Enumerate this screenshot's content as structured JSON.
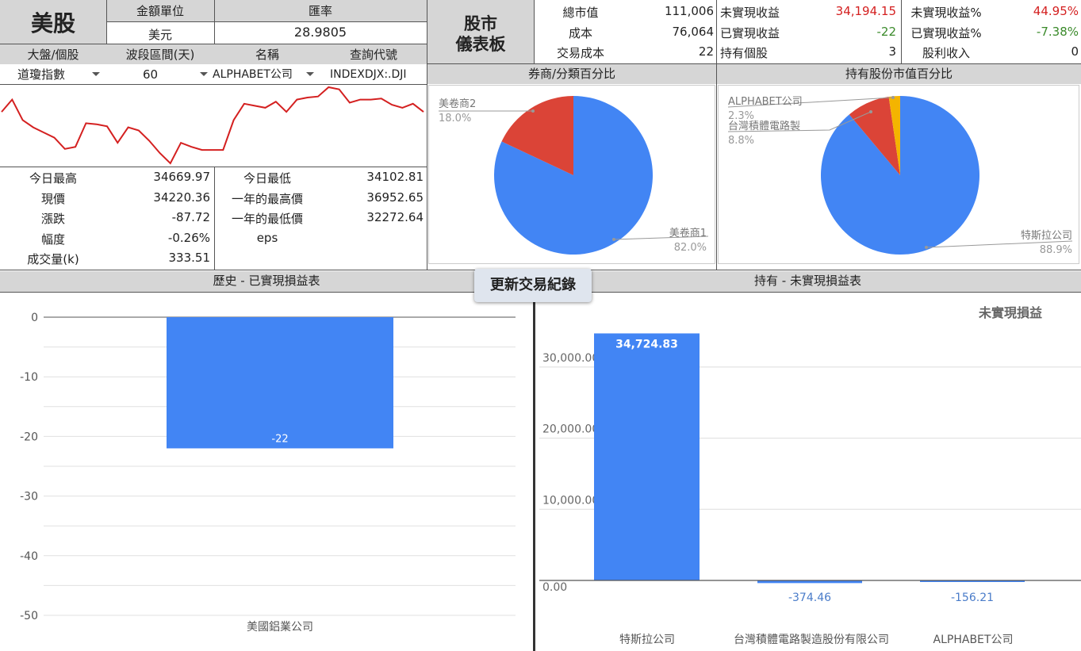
{
  "market": {
    "title": "美股",
    "amount_unit_label": "金額單位",
    "amount_unit_value": "美元",
    "exchange_rate_label": "匯率",
    "exchange_rate_value": "28.9805",
    "col_headers": [
      "大盤/個股",
      "波段區間(天)",
      "名稱",
      "查詢代號"
    ],
    "select_index": "道瓊指數",
    "select_days": "60",
    "select_name": "ALPHABET公司",
    "query_code": "INDEXDJX:.DJI",
    "sparkline": [
      34380,
      34500,
      34300,
      34230,
      34180,
      34130,
      34020,
      34040,
      34270,
      34260,
      34240,
      34080,
      34230,
      34200,
      34100,
      33980,
      33880,
      34080,
      34040,
      34010,
      34010,
      34010,
      34300,
      34460,
      34440,
      34420,
      34480,
      34380,
      34500,
      34520,
      34530,
      34620,
      34600,
      34470,
      34500,
      34500,
      34510,
      34450,
      34420,
      34460,
      34380
    ]
  },
  "stats": {
    "left": [
      {
        "label": "今日最高",
        "value": "34669.97"
      },
      {
        "label": "現價",
        "value": "34220.36"
      },
      {
        "label": "漲跌",
        "value": "-87.72"
      },
      {
        "label": "幅度",
        "value": "-0.26%"
      },
      {
        "label": "成交量(k)",
        "value": "333.51"
      }
    ],
    "right": [
      {
        "label": "今日最低",
        "value": "34102.81"
      },
      {
        "label": "一年的最高價",
        "value": "36952.65"
      },
      {
        "label": "一年的最低價",
        "value": "32272.64"
      },
      {
        "label": "eps",
        "value": ""
      }
    ]
  },
  "dashboard": {
    "title_line1": "股市",
    "title_line2": "儀表板",
    "col1": [
      {
        "label": "總市值",
        "value": "111,006"
      },
      {
        "label": "成本",
        "value": "76,064"
      },
      {
        "label": "交易成本",
        "value": "22"
      }
    ],
    "col2": [
      {
        "label": "未實現收益",
        "value": "34,194.15",
        "color": "#d42020"
      },
      {
        "label": "已實現收益",
        "value": "-22",
        "color": "#3a8a2a"
      },
      {
        "label": "持有個股",
        "value": "3",
        "color": "#222222"
      }
    ],
    "col3": [
      {
        "label": "未實現收益%",
        "value": "44.95%",
        "color": "#d42020"
      },
      {
        "label": "已實現收益%",
        "value": "-7.38%",
        "color": "#3a8a2a"
      },
      {
        "label": "股利收入",
        "value": "0",
        "color": "#222222"
      }
    ]
  },
  "broker_pie": {
    "title": "券商/分類百分比",
    "chart_data": {
      "type": "pie",
      "slices": [
        {
          "name": "美卷商1",
          "value": 82.0,
          "label": "82.0%",
          "color": "#4285f4"
        },
        {
          "name": "美卷商2",
          "value": 18.0,
          "label": "18.0%",
          "color": "#db4437"
        }
      ]
    }
  },
  "holding_pie": {
    "title": "持有股份市值百分比",
    "chart_data": {
      "type": "pie",
      "slices": [
        {
          "name": "特斯拉公司",
          "value": 88.9,
          "label": "88.9%",
          "color": "#4285f4"
        },
        {
          "name": "台灣積體電路製",
          "value": 8.8,
          "label": "8.8%",
          "color": "#db4437"
        },
        {
          "name": "ALPHABET公司",
          "value": 2.3,
          "label": "2.3%",
          "color": "#f4b400"
        }
      ]
    }
  },
  "realized": {
    "title": "歷史 - 已實現損益表",
    "chart_data": {
      "type": "bar",
      "categories": [
        "美國鋁業公司"
      ],
      "values": [
        -22
      ],
      "data_labels": [
        "-22"
      ],
      "ylim": [
        -50,
        0
      ],
      "yticks": [
        0,
        -10,
        -20,
        -30,
        -40,
        -50
      ],
      "color": "#4285f4"
    }
  },
  "update_button": "更新交易紀錄",
  "unrealized": {
    "title": "持有 - 未實現損益表",
    "chart_data": {
      "type": "bar",
      "title": "未實現損益",
      "categories": [
        "特斯拉公司",
        "台灣積體電路製造股份有限公司",
        "ALPHABET公司"
      ],
      "values": [
        34724.83,
        -374.46,
        -156.21
      ],
      "data_labels": [
        "34,724.83",
        "-374.46",
        "-156.21"
      ],
      "ylim": [
        0,
        35000
      ],
      "yticks": [
        0,
        10000,
        20000,
        30000
      ],
      "ytick_labels": [
        "0.00",
        "10,000.00",
        "20,000.00",
        "30,000.00"
      ],
      "color": "#4285f4"
    }
  }
}
